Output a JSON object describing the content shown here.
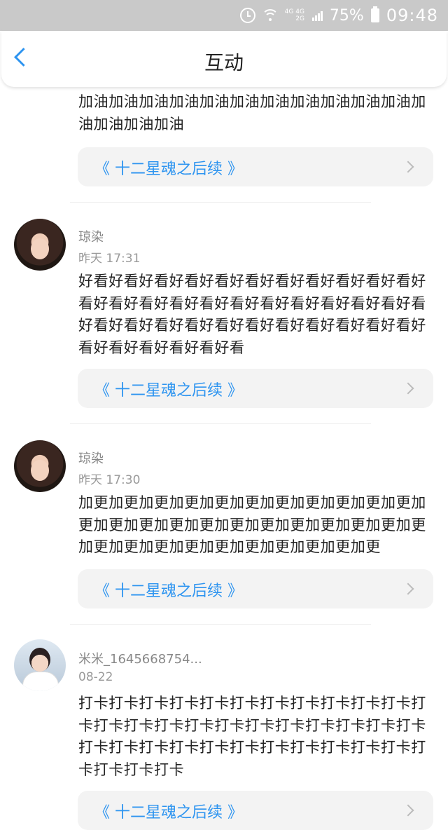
{
  "status_bar": {
    "network_top": "4G 4G",
    "network_bottom": "2G",
    "battery": "75%",
    "time": "09:48"
  },
  "header": {
    "title": "互动"
  },
  "comments": [
    {
      "text": "加油加油加油加油加油加油加油加油加油加油加油加油加油加油加油"
    },
    {
      "user": "琼染",
      "time": "昨天 17:31",
      "text": "好看好看好看好看好看好看好看好看好看好看好看好看好看好看好看好看好看好看好看好看好看好看好看好看好看好看好看好看好看好看好看好看好看好看好看好看好看好看好看好看"
    },
    {
      "user": "琼染",
      "time": "昨天 17:30",
      "text": "加更加更加更加更加更加更加更加更加更加更加更加更加更加更加更加更加更加更加更加更加更加更加更加更加更加更加更加更加更加更加更加更加更"
    },
    {
      "user": "米米_1645668754...",
      "time": "08-22",
      "text": "打卡打卡打卡打卡打卡打卡打卡打卡打卡打卡打卡打卡打卡打卡打卡打卡打卡打卡打卡打卡打卡打卡打卡打卡打卡打卡打卡打卡打卡打卡打卡打卡打卡打卡打卡打卡打卡打卡"
    }
  ],
  "book_link": "《 十二星魂之后续 》",
  "colors": {
    "accent": "#2d94f0",
    "status_bar": "#c9c9c9",
    "card_bg": "#f3f3f3"
  }
}
